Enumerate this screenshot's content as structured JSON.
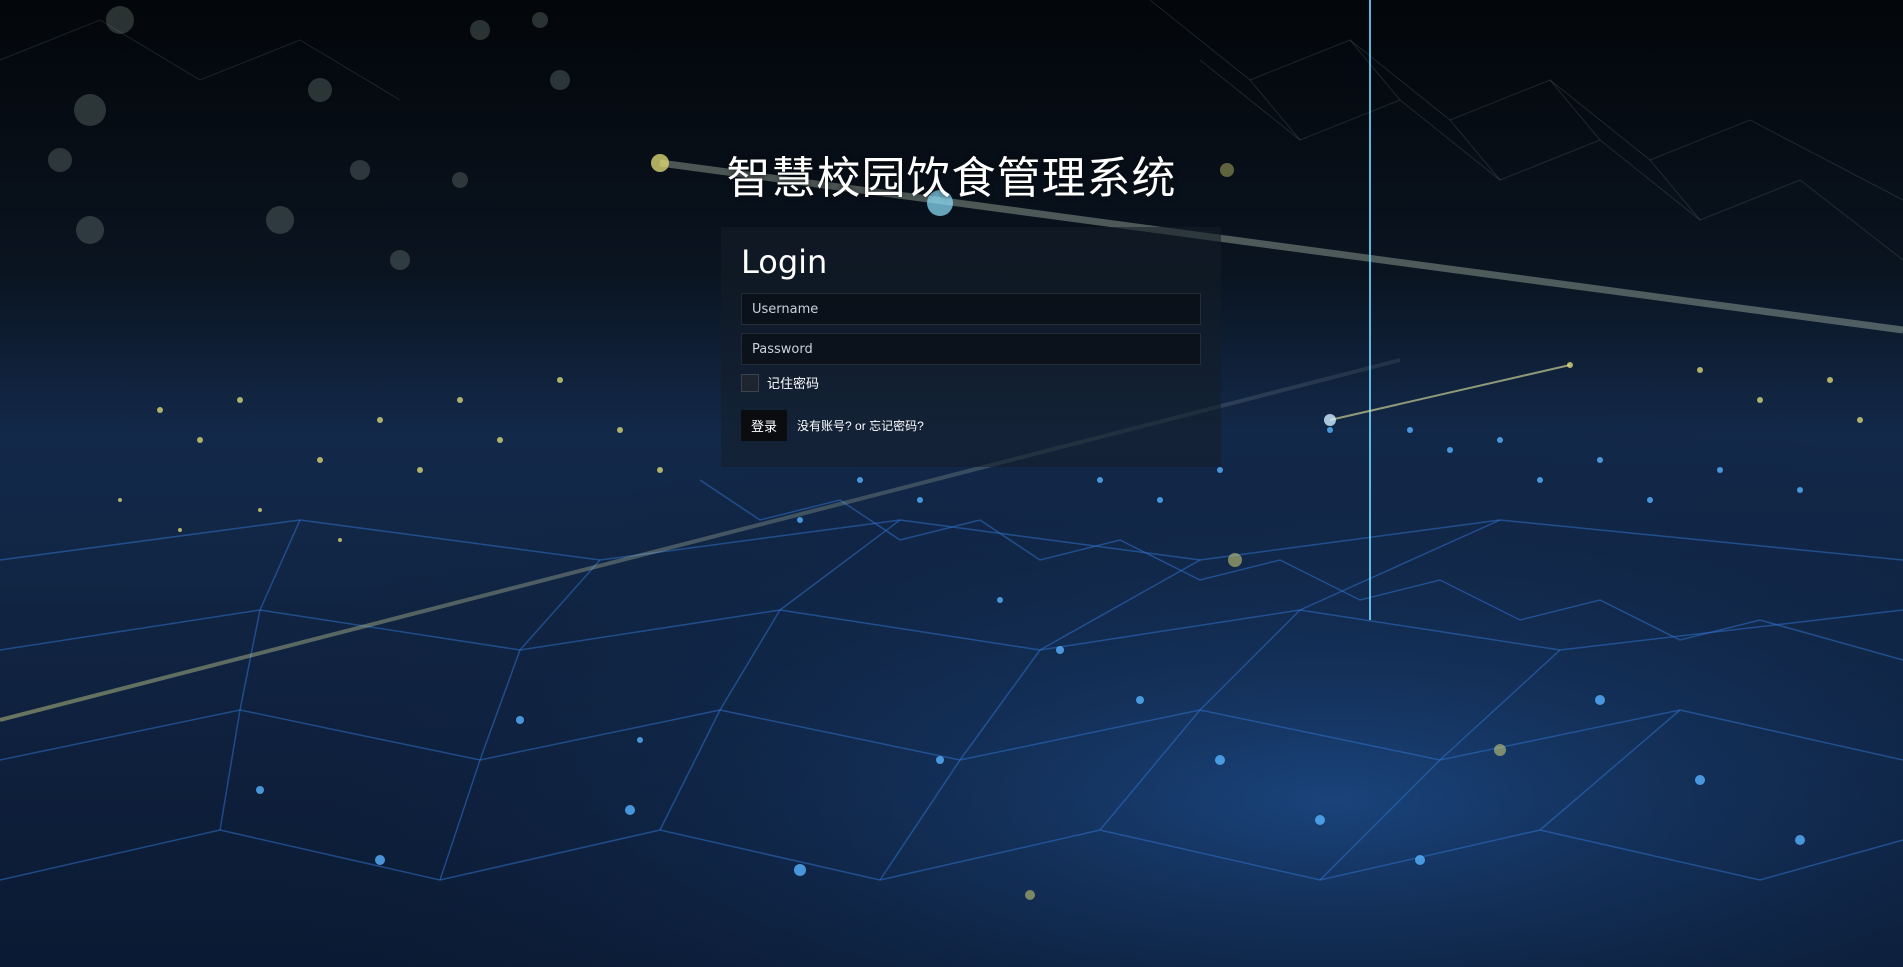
{
  "header": {
    "title": "智慧校园饮食管理系统"
  },
  "login": {
    "heading": "Login",
    "username_placeholder": "Username",
    "password_placeholder": "Password",
    "remember_label": "记住密码",
    "submit_label": "登录",
    "no_account_link": "没有账号?",
    "or_text": "or",
    "forgot_link": "忘记密码?"
  },
  "colors": {
    "background_dark": "#05080d",
    "grid_blue": "#3a7bd5",
    "glow_yellow": "#e6e27a",
    "beam_cyan": "#6fd6ff"
  }
}
